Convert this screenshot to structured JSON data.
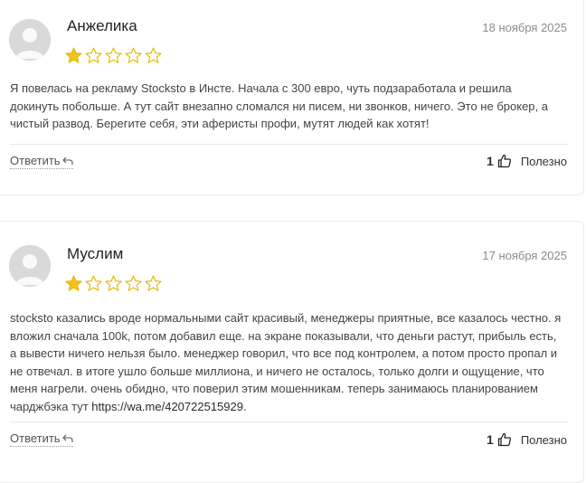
{
  "reviews": [
    {
      "author": "Анжелика",
      "date": "18 ноября 2025",
      "rating": 1,
      "rating_max": 5,
      "text": "Я повелась на рекламу Stocksto в Инсте. Начала с 300 евро, чуть подзаработала и решила докинуть побольше. А тут сайт внезапно сломался ни писем, ни звонков, ничего. Это не брокер, а чистый развод. Берегите себя, эти аферисты профи, мутят людей как хотят!",
      "reply_label": "Ответить",
      "likes": "1",
      "helpful_label": "Полезно"
    },
    {
      "author": "Муслим",
      "date": "17 ноября 2025",
      "rating": 1,
      "rating_max": 5,
      "text": "stocksto казались вроде нормальными сайт красивый, менеджеры приятные, все казалось честно. я вложил сначала 100k, потом добавил еще. на экране показывали, что деньги растут, прибыль есть, а вывести ничего нельзя было. менеджер говорил, что все под контролем, а потом просто пропал и не отвечал. в итоге ушло больше миллиона, и ничего не осталось, только долги и ощущение, что меня нагрели. очень обидно, что поверил этим мошенникам. теперь занимаюсь планированием чарджбэка тут",
      "link": "https://wa.me/420722515929",
      "text_end": ".",
      "reply_label": "Ответить",
      "likes": "1",
      "helpful_label": "Полезно"
    }
  ],
  "colors": {
    "star_filled": "#f2c318",
    "star_outline": "#e6b800",
    "avatar_bg": "#d9d9d9",
    "date": "#8a8a8a"
  },
  "icons": {
    "star": "star-icon",
    "reply": "reply-arrow-icon",
    "like": "thumbs-up-icon",
    "avatar": "user-avatar-icon"
  }
}
